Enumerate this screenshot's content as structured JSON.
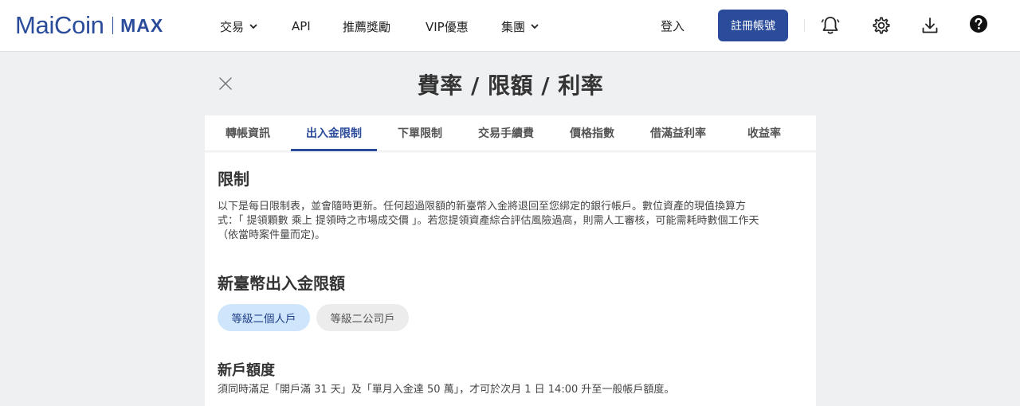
{
  "header": {
    "logo_main": "MaiCoin",
    "logo_max": "MAX",
    "nav": [
      {
        "label": "交易",
        "has_dropdown": true
      },
      {
        "label": "API",
        "has_dropdown": false
      },
      {
        "label": "推薦獎勵",
        "has_dropdown": false
      },
      {
        "label": "VIP優惠",
        "has_dropdown": false
      },
      {
        "label": "集團",
        "has_dropdown": true
      }
    ],
    "login_label": "登入",
    "register_label": "註冊帳號",
    "icons": [
      "bell-icon",
      "gear-icon",
      "download-icon",
      "help-icon"
    ]
  },
  "page": {
    "title": "費率 / 限額 / 利率",
    "close_icon": "close-icon"
  },
  "tabs": [
    {
      "label": "轉帳資訊",
      "active": false
    },
    {
      "label": "出入金限制",
      "active": true
    },
    {
      "label": "下單限制",
      "active": false
    },
    {
      "label": "交易手續費",
      "active": false
    },
    {
      "label": "價格指數",
      "active": false
    },
    {
      "label": "借滿益利率",
      "active": false
    },
    {
      "label": "收益率",
      "active": false
    }
  ],
  "content": {
    "section_title": "限制",
    "intro_lines": [
      "以下是每日限制表，並會隨時更新。任何超過限額的新臺幣入金將退回至您綁定的銀行帳戶。數位資產的現值換算方",
      "式：「 提領顆數 乘上 提領時之市場成交價 」。若您提領資產綜合評估風險過高，則需人工審核，可能需耗時數個工作天",
      "（依當時案件量而定)。"
    ],
    "twd_title": "新臺幣出入金限額",
    "pills": [
      {
        "label": "等級二個人戶",
        "active": true
      },
      {
        "label": "等級二公司戶",
        "active": false
      }
    ],
    "new_account_title": "新戶額度",
    "new_account_desc": "須同時滿足「開戶滿 31 天」及「單月入金達 50 萬」，才可於次月 1 日 14:00 升至一般帳戶額度。"
  },
  "colors": {
    "brand": "#2b4c9b",
    "pill_active_bg": "#cfe5fb",
    "pill_inactive_bg": "#ececec"
  }
}
